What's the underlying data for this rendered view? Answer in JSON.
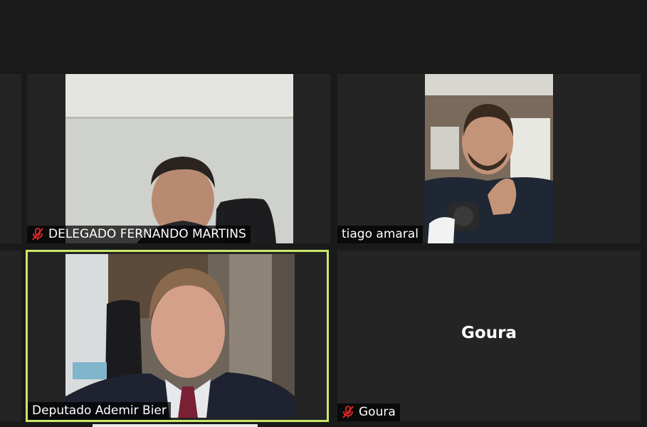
{
  "participants": [
    {
      "name": "DELEGADO FERNANDO MARTINS",
      "muted": true,
      "video": true
    },
    {
      "name": "tiago amaral",
      "muted": false,
      "video": true
    },
    {
      "name": "Deputado Ademir Bier",
      "muted": false,
      "video": true,
      "active_speaker": true
    },
    {
      "name": "Goura",
      "muted": true,
      "video": false
    }
  ],
  "colors": {
    "background": "#1a1a1a",
    "tile": "#242424",
    "active_speaker_border": "#c9e86a",
    "mute_icon": "#e02828"
  },
  "icons": {
    "muted": "microphone-muted-icon"
  }
}
